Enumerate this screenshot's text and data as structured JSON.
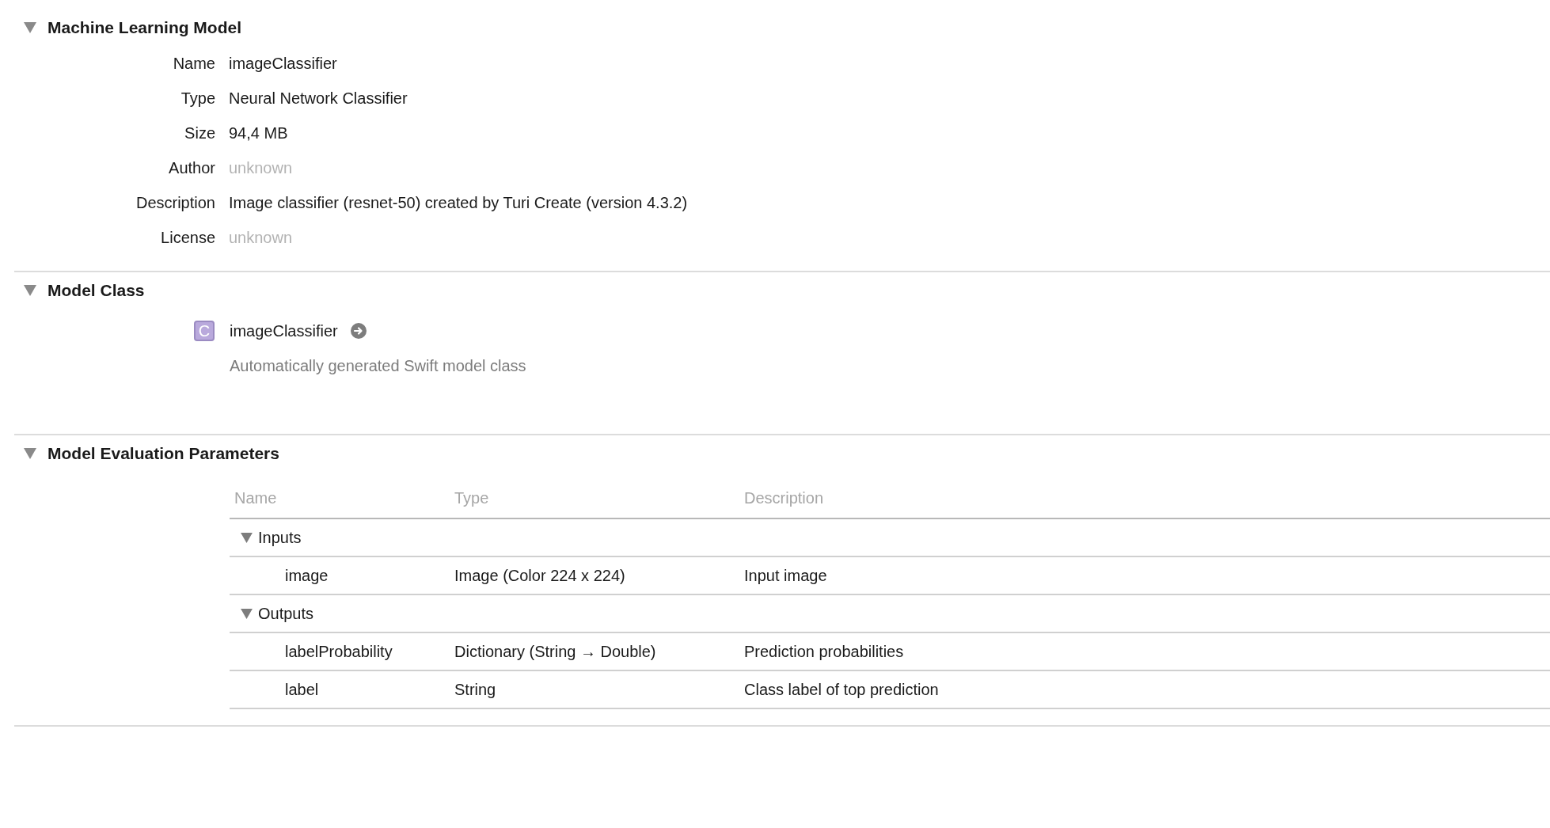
{
  "sections": [
    {
      "kind": "properties",
      "title": "Machine Learning Model",
      "expanded": true,
      "properties": [
        {
          "label": "Name",
          "value": "imageClassifier",
          "dimmed": false
        },
        {
          "label": "Type",
          "value": "Neural Network Classifier",
          "dimmed": false
        },
        {
          "label": "Size",
          "value": "94,4 MB",
          "dimmed": false
        },
        {
          "label": "Author",
          "value": "unknown",
          "dimmed": true
        },
        {
          "label": "Description",
          "value": "Image classifier (resnet-50) created by Turi Create (version 4.3.2)",
          "dimmed": false
        },
        {
          "label": "License",
          "value": "unknown",
          "dimmed": true
        }
      ]
    },
    {
      "kind": "model_class",
      "title": "Model Class",
      "expanded": true,
      "class_name": "imageClassifier",
      "class_icon": "C",
      "description": "Automatically generated Swift model class"
    },
    {
      "kind": "parameters",
      "title": "Model Evaluation Parameters",
      "expanded": true,
      "columns": [
        "Name",
        "Type",
        "Description"
      ],
      "groups": [
        {
          "label": "Inputs",
          "expanded": true,
          "rows": [
            {
              "name": "image",
              "type": "Image (Color 224 x 224)",
              "description": "Input image"
            }
          ]
        },
        {
          "label": "Outputs",
          "expanded": true,
          "rows": [
            {
              "name": "labelProbability",
              "type": "Dictionary (String → Double)",
              "description": "Prediction probabilities"
            },
            {
              "name": "label",
              "type": "String",
              "description": "Class label of top prediction"
            }
          ]
        }
      ]
    }
  ]
}
